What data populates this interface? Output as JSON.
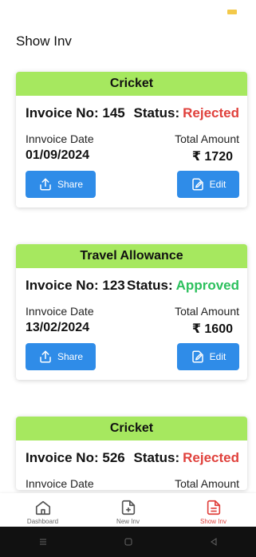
{
  "page": {
    "title": "Show Inv"
  },
  "labels": {
    "invoice_prefix": "Invoice No:",
    "status_prefix": "Status:",
    "date_label": "Innvoice Date",
    "amount_label": "Total Amount",
    "share": "Share",
    "edit": "Edit"
  },
  "invoices": [
    {
      "category": "Cricket",
      "invoice_no": "145",
      "status": "Rejected",
      "date": "01/09/2024",
      "amount": "₹ 1720"
    },
    {
      "category": "Travel Allowance",
      "invoice_no": "123",
      "status": "Approved",
      "date": "13/02/2024",
      "amount": "₹ 1600"
    },
    {
      "category": "Cricket",
      "invoice_no": "526",
      "status": "Rejected",
      "date": "",
      "amount": ""
    }
  ],
  "nav": {
    "items": [
      {
        "label": "Dashboard",
        "icon": "home-icon",
        "active": false
      },
      {
        "label": "New Inv",
        "icon": "add-file-icon",
        "active": false
      },
      {
        "label": "Show Inv",
        "icon": "file-text-icon",
        "active": true
      }
    ]
  },
  "colors": {
    "header": "#a6e85f",
    "button": "#2f8ce8",
    "rejected": "#e0413c",
    "approved": "#2cc05d",
    "active_nav": "#e0413c"
  }
}
